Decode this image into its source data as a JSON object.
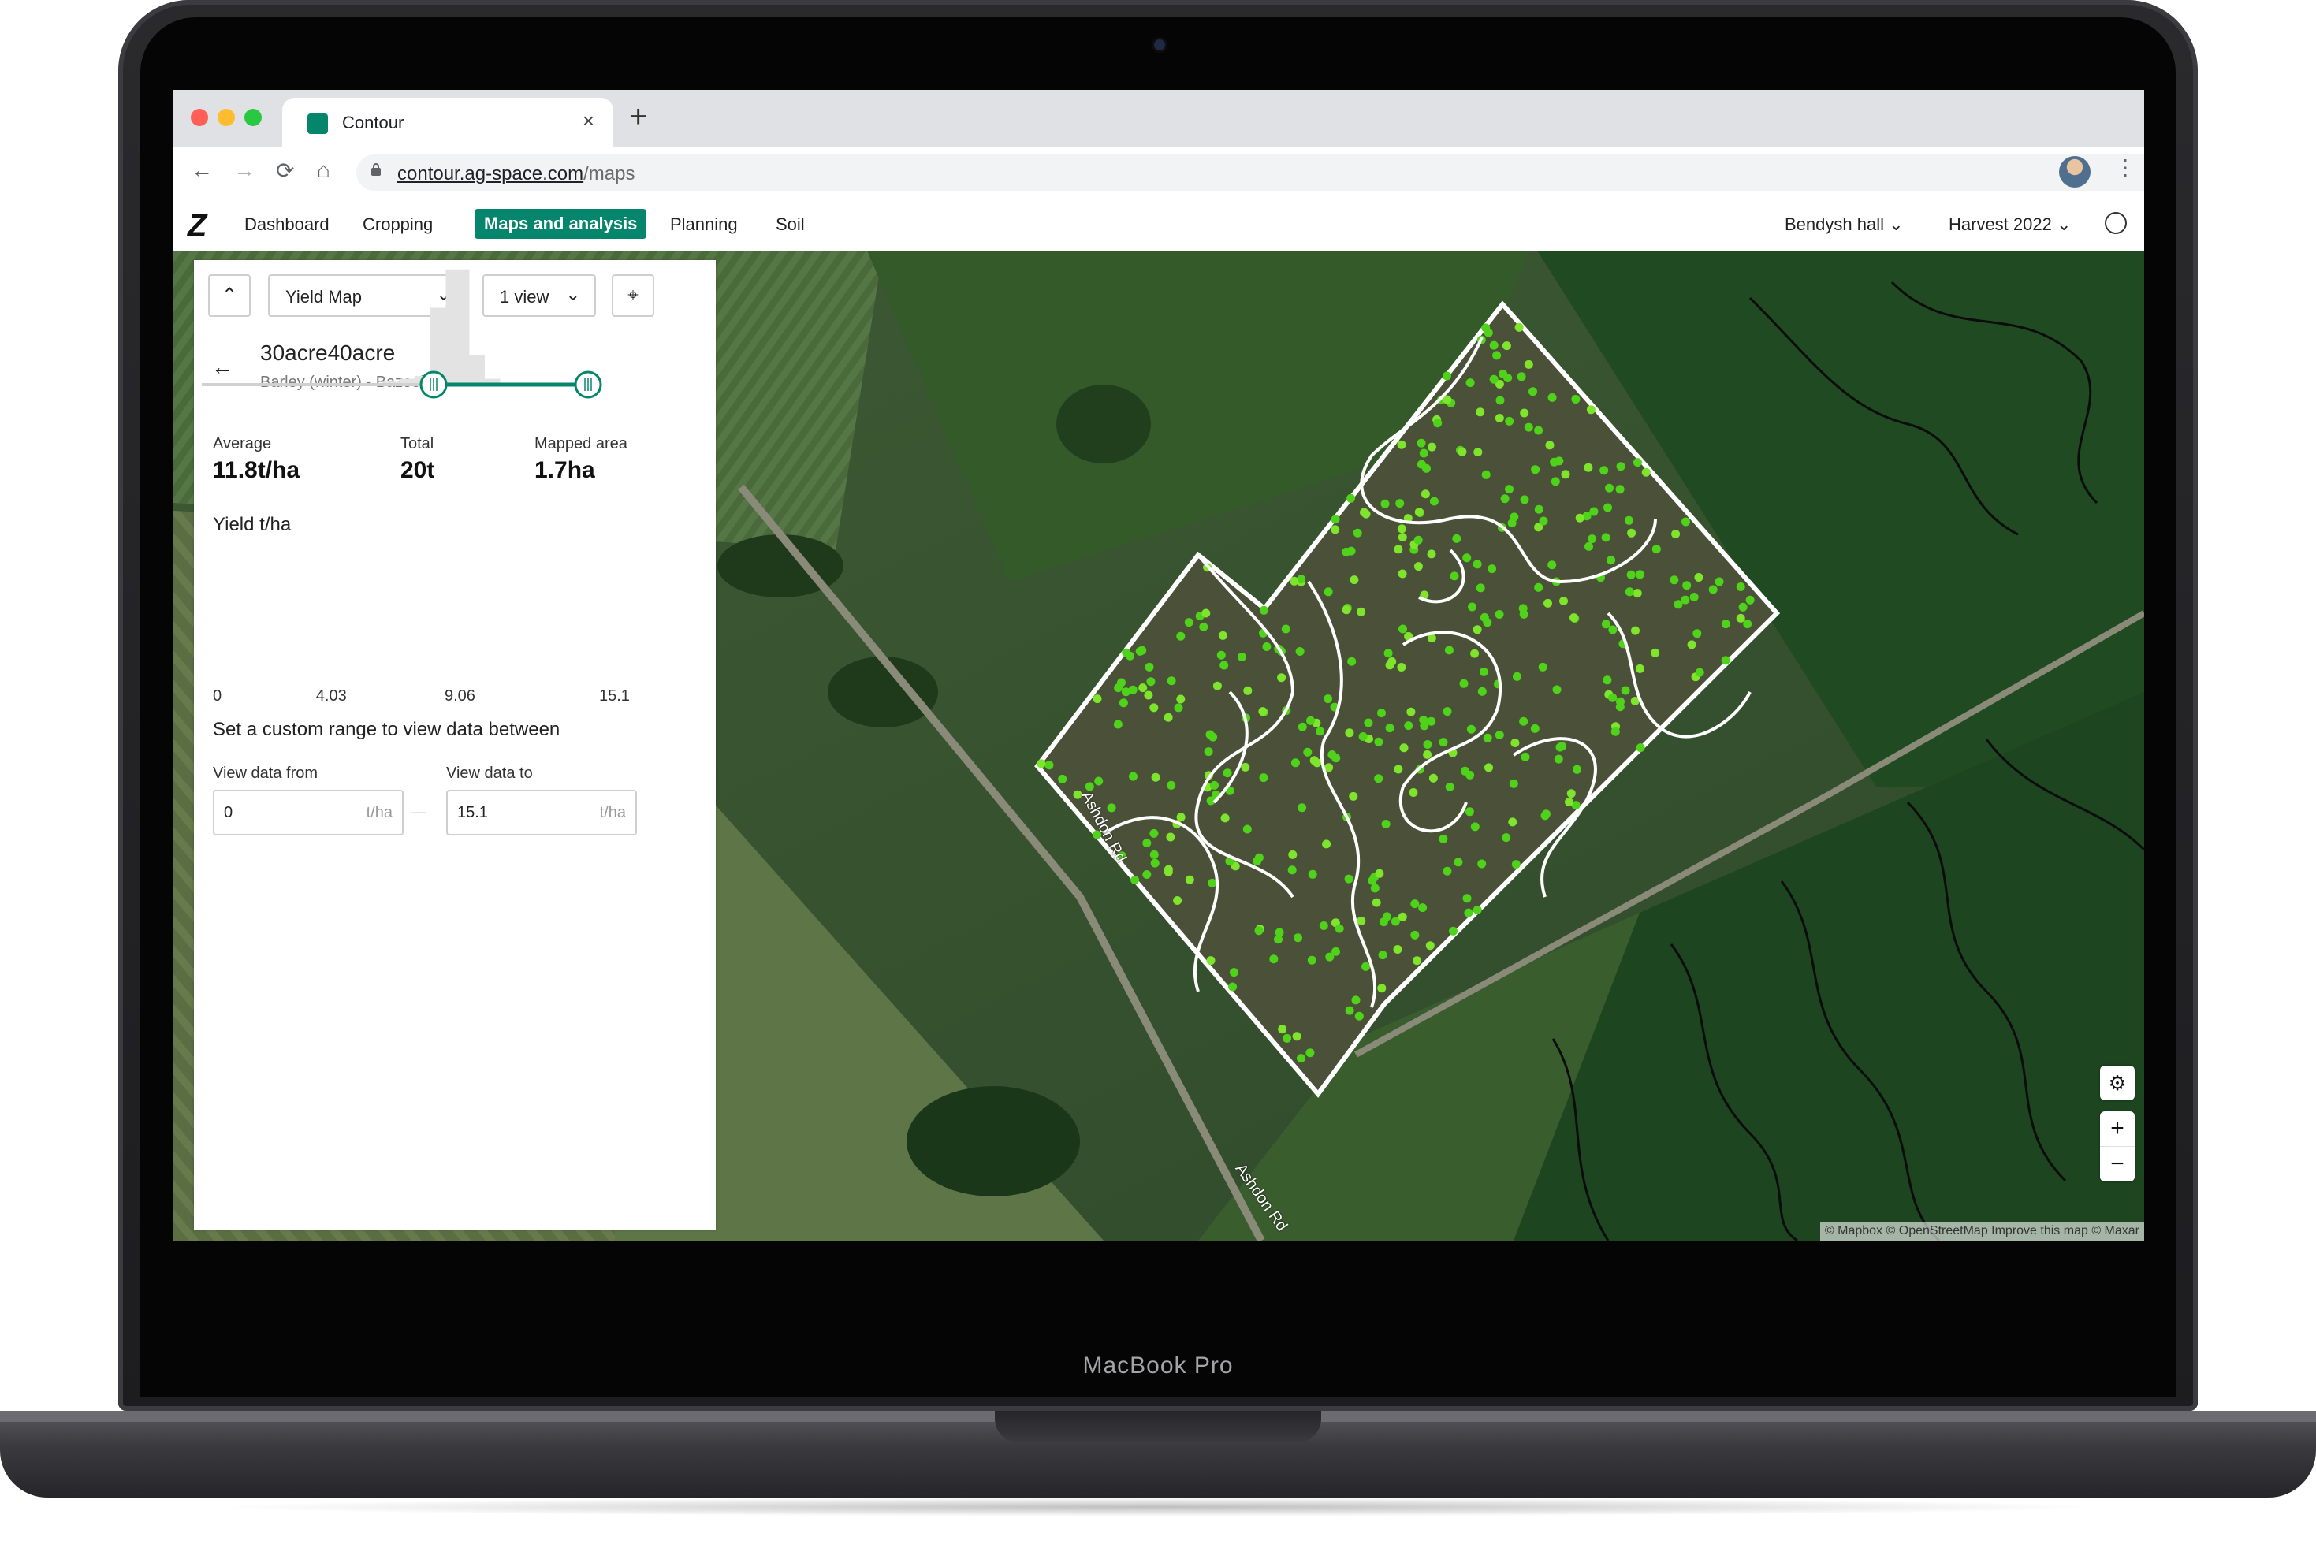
{
  "device": {
    "label": "MacBook Pro"
  },
  "browser": {
    "tab_title": "Contour",
    "close_glyph": "×",
    "new_tab_glyph": "+",
    "url_domain": "contour.ag-space.com",
    "url_path": "/maps",
    "traffic_lights": [
      "#ff5f57",
      "#febc2e",
      "#28c840"
    ]
  },
  "app": {
    "logo": "Z",
    "nav": {
      "dashboard": "Dashboard",
      "cropping": "Cropping",
      "maps": "Maps and analysis",
      "planning": "Planning",
      "soil": "Soil"
    },
    "farm": "Bendysh hall",
    "season": "Harvest 2022",
    "accent": "#05856b"
  },
  "panel": {
    "map_type": "Yield Map",
    "view_count": "1 view",
    "field_name": "30acre40acre",
    "field_crop": "Barley (winter) - Bazooka",
    "stats": {
      "average_label": "Average",
      "average_value": "11.8t/ha",
      "total_label": "Total",
      "total_value": "20t",
      "area_label": "Mapped area",
      "area_value": "1.7ha"
    },
    "chart_title": "Yield t/ha",
    "ticks": [
      "0",
      "4.03",
      "9.06",
      "15.1"
    ],
    "range_hint": "Set a custom range to view data between",
    "from_label": "View data from",
    "from_value": "0",
    "to_label": "View data to",
    "to_value": "15.1",
    "unit": "t/ha",
    "range_separator": "—"
  },
  "chart_data": {
    "type": "bar",
    "xlim": [
      0,
      15.1
    ],
    "bins": [
      {
        "x": 5.5,
        "value": 1
      },
      {
        "x": 6.5,
        "value": 1
      },
      {
        "x": 7.5,
        "value": 2
      },
      {
        "x": 8.2,
        "value": 4
      },
      {
        "x": 8.8,
        "value": 6
      },
      {
        "x": 9.4,
        "value": 52
      },
      {
        "x": 10.0,
        "value": 78
      },
      {
        "x": 10.6,
        "value": 20
      },
      {
        "x": 11.2,
        "value": 4
      }
    ],
    "range_selected": [
      9.06,
      15.1
    ],
    "ymax": 80
  },
  "map": {
    "road_labels": [
      "Ashdon Rd",
      "Ashdon Rd"
    ],
    "attribution": "© Mapbox © OpenStreetMap Improve this map © Maxar",
    "zoom_in": "+",
    "zoom_out": "−",
    "settings_icon": "gear-icon"
  }
}
